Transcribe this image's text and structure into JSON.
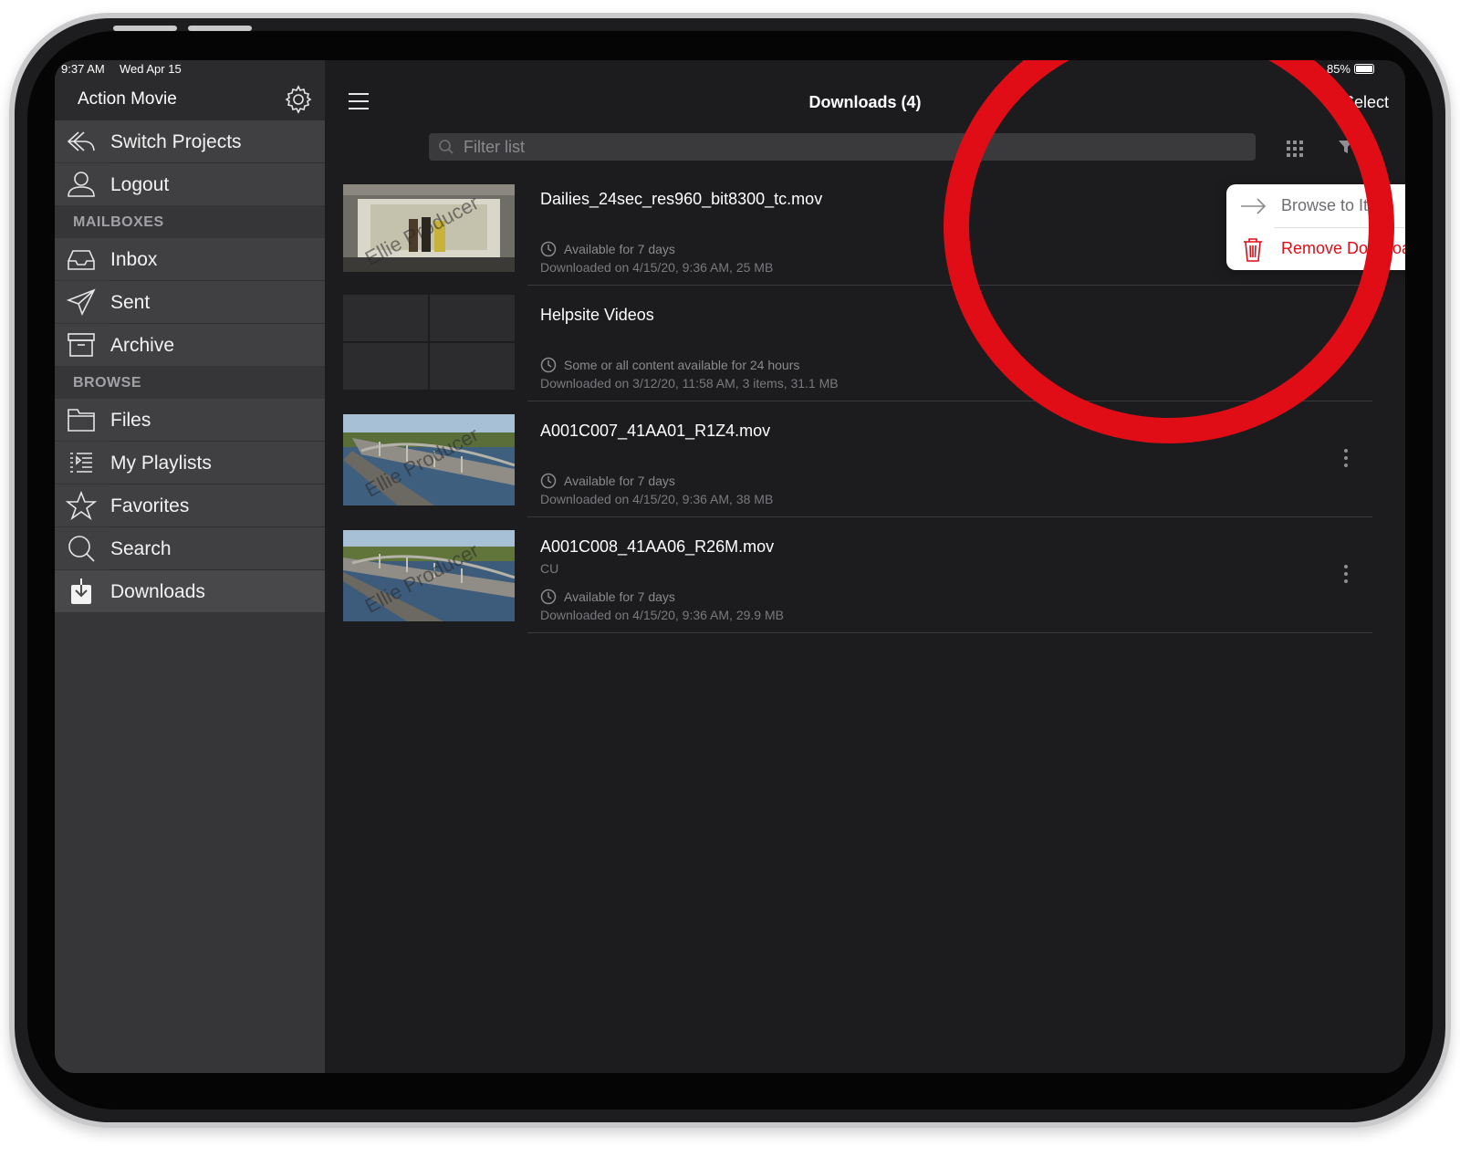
{
  "status": {
    "time": "9:37 AM",
    "date": "Wed Apr 15",
    "battery": "85%"
  },
  "sidebar": {
    "title": "Action Movie",
    "switch_projects": "Switch Projects",
    "logout": "Logout",
    "mailboxes_header": "MAILBOXES",
    "inbox": "Inbox",
    "sent": "Sent",
    "archive": "Archive",
    "browse_header": "BROWSE",
    "files": "Files",
    "my_playlists": "My Playlists",
    "favorites": "Favorites",
    "search": "Search",
    "downloads": "Downloads"
  },
  "header": {
    "title": "Downloads (4)",
    "select": "Select"
  },
  "filter": {
    "placeholder": "Filter list"
  },
  "popover": {
    "browse": "Browse to Item",
    "remove": "Remove Download"
  },
  "items": [
    {
      "name": "Dailies_24sec_res960_bit8300_tc.mov",
      "sub": "",
      "avail": "Available for 7 days",
      "info": "Downloaded on 4/15/20, 9:36 AM, 25 MB",
      "watermark": "Ellie Producer"
    },
    {
      "name": "Helpsite Videos",
      "sub": "",
      "avail": "Some or all content available for 24 hours",
      "info": "Downloaded on 3/12/20, 11:58 AM, 3 items, 31.1 MB"
    },
    {
      "name": "A001C007_41AA01_R1Z4.mov",
      "sub": "",
      "avail": "Available for 7 days",
      "info": "Downloaded on 4/15/20, 9:36 AM, 38 MB",
      "watermark": "Ellie Producer"
    },
    {
      "name": "A001C008_41AA06_R26M.mov",
      "sub": "CU",
      "avail": "Available for 7 days",
      "info": "Downloaded on 4/15/20, 9:36 AM, 29.9 MB",
      "watermark": "Ellie Producer"
    }
  ],
  "colors": {
    "accent_red": "#e00d16",
    "sidebar_bg": "#363638",
    "main_bg": "#1c1c1e"
  }
}
